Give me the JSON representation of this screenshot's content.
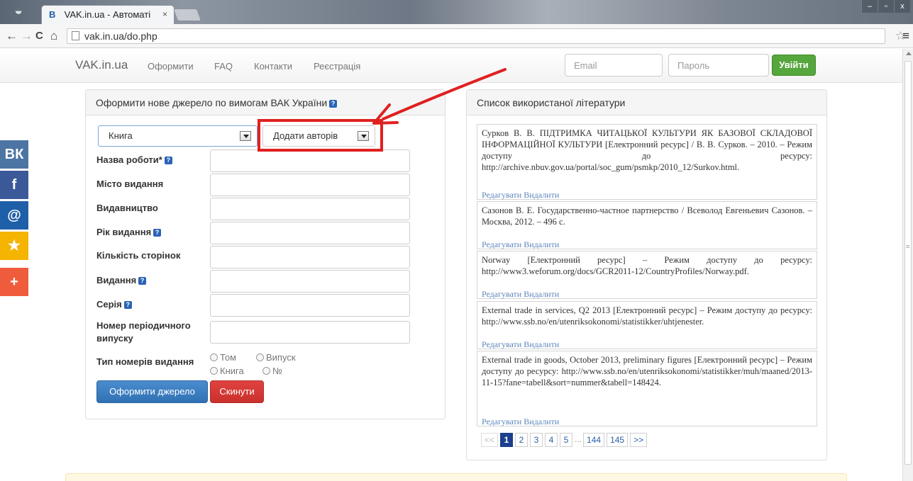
{
  "browser": {
    "tab_title": "VAK.in.ua - Автоматі",
    "tab_favicon": "B",
    "close_glyph": "×",
    "url": "vak.in.ua/do.php",
    "back_glyph": "←",
    "forward_glyph": "→",
    "reload_glyph": "C",
    "home_glyph": "⌂",
    "star_glyph": "☆",
    "menu_glyph": "≡",
    "win_minimize": "–",
    "win_maximize": "▫",
    "win_close": "x"
  },
  "nav": {
    "brand": "VAK.in.ua",
    "links": [
      "Оформити",
      "FAQ",
      "Контакти",
      "Реєстрація"
    ],
    "email_placeholder": "Email",
    "password_placeholder": "Пароль",
    "login_label": "Увійти"
  },
  "social": [
    {
      "glyph": "ВК",
      "color": "#4c75a3"
    },
    {
      "glyph": "f",
      "color": "#3b5998"
    },
    {
      "glyph": "@",
      "color": "#1f5fa8"
    },
    {
      "glyph": "★",
      "color": "#f4b400"
    },
    {
      "glyph": "+",
      "color": "#ef5c3c"
    }
  ],
  "form": {
    "heading": "Оформити нове джерело по вимогам ВАК України",
    "help_glyph": "?",
    "source_type": "Книга",
    "add_authors": "Додати авторів",
    "fields": [
      {
        "label": "Назва роботи*",
        "help": true
      },
      {
        "label": "Місто видання",
        "help": false
      },
      {
        "label": "Видавництво",
        "help": false
      },
      {
        "label": "Рік видання",
        "help": true
      },
      {
        "label": "Кількість сторінок",
        "help": false
      },
      {
        "label": "Видання",
        "help": true
      },
      {
        "label": "Серія",
        "help": true
      },
      {
        "label": "Номер періодичного випуску",
        "help": false
      }
    ],
    "numbering_label": "Тип номерів видання",
    "radios": [
      "Том",
      "Випуск",
      "Книга",
      "№"
    ],
    "submit_label": "Оформити джерело",
    "reset_label": "Скинути"
  },
  "literature": {
    "heading": "Список використаної літератури",
    "edit_label": "Редагувати",
    "delete_label": "Видалити",
    "items": [
      "Сурков В. В. ПІДТРИМКА ЧИТАЦЬКОЇ КУЛЬТУРИ ЯК БАЗОВОЇ СКЛАДОВОЇ ІНФОРМАЦІЙНОЇ КУЛЬТУРИ [Електронний ресурс] / В. В. Сурков. – 2010. – Режим доступу до ресурсу: http://archive.nbuv.gov.ua/portal/soc_gum/psmkp/2010_12/Surkov.html.",
      "Сазонов В. Е. Государственно-частное партнерство / Всеволод Евгеньевич Сазонов. – Москва, 2012. – 496 с.",
      "Norway [Електронний ресурс] – Режим доступу до ресурсу: http://www3.weforum.org/docs/GCR2011-12/CountryProfiles/Norway.pdf.",
      "External trade in services, Q2 2013 [Електронний ресурс] – Режим доступу до ресурсу: http://www.ssb.no/en/utenriksokonomi/statistikker/uhtjenester.",
      "External trade in goods, October 2013, preliminary figures [Електронний ресурс] – Режим доступу до ресурсу: http://www.ssb.no/en/utenriksokonomi/statistikker/muh/maaned/2013-11-15?fane=tabell&sort=nummer&tabell=148424."
    ]
  },
  "pagination": {
    "prev": "<<",
    "pages": [
      "1",
      "2",
      "3",
      "4",
      "5"
    ],
    "ellipsis": "...",
    "last_pages": [
      "144",
      "145"
    ],
    "next": ">>",
    "current": "1"
  },
  "colors": {
    "annotation_red": "#e02020",
    "login_green": "#55a63d",
    "primary_blue": "#3071b3",
    "danger_red": "#c9302c",
    "link_blue": "#5b86bd"
  }
}
